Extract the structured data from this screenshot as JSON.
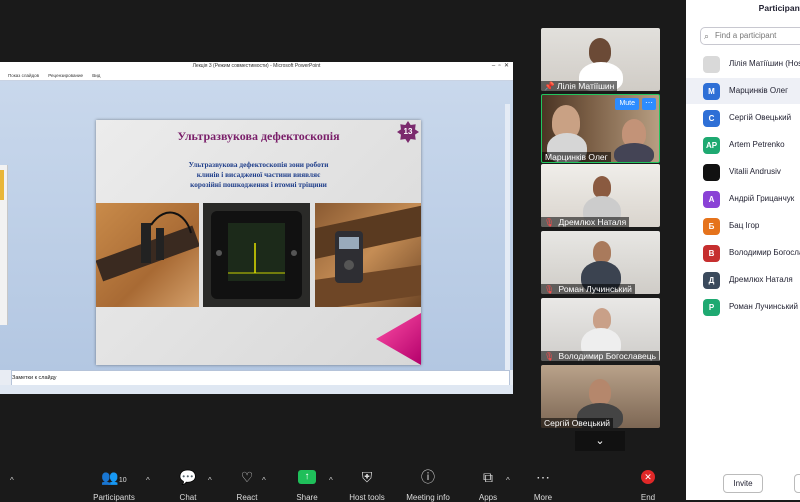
{
  "ppt": {
    "window_title": "Лекція 3 (Режим совместимости) - Microsoft PowerPoint",
    "menu_items": [
      "Показ слайдов",
      "Рецензирование",
      "Вид"
    ],
    "notes_placeholder": "Заметки к слайду"
  },
  "slide": {
    "title": "Ультразвукова дефектоскопія",
    "number": "13",
    "body_lines": [
      "Ультразвукова дефектоскопія зони роботи",
      "клинів і висадженої частини виявляє",
      "корозійні пошкодження і втомні тріщини"
    ]
  },
  "video_tiles": [
    {
      "name": "Лілія Матіїшин",
      "pinned": true
    },
    {
      "name": "Марцинків Олег",
      "active": true,
      "mute_label": "Mute"
    },
    {
      "name": "Дремлюх Наталя",
      "muted": true
    },
    {
      "name": "Роман Лучинський",
      "muted": true
    },
    {
      "name": "Володимир Богославець",
      "muted": true
    },
    {
      "name": "Сергій Овецький"
    }
  ],
  "panel": {
    "title": "Participants",
    "search_placeholder": "Find a participant",
    "participants": [
      {
        "initial": "",
        "name": "Лілія Матіїшин (Host)",
        "color": "#d9d9d9"
      },
      {
        "initial": "М",
        "name": "Марцинків Олег",
        "color": "#2e6fd6"
      },
      {
        "initial": "С",
        "name": "Сергій Овецький",
        "color": "#2e6fd6"
      },
      {
        "initial": "AP",
        "name": "Artem Petrenko",
        "color": "#1ea971"
      },
      {
        "initial": "",
        "name": "Vitalii Andrusiv",
        "color": "#111111"
      },
      {
        "initial": "А",
        "name": "Андрій Грицанчук",
        "color": "#8a42d6"
      },
      {
        "initial": "Б",
        "name": "Бац Ігор",
        "color": "#e5731c"
      },
      {
        "initial": "В",
        "name": "Володимир Богославець",
        "color": "#c62f2f"
      },
      {
        "initial": "Д",
        "name": "Дремлюх Наталя",
        "color": "#3a4a5c"
      },
      {
        "initial": "Р",
        "name": "Роман Лучинський",
        "color": "#1ea971"
      }
    ],
    "invite_label": "Invite"
  },
  "toolbar": {
    "participants_label": "Participants",
    "participants_count": "10",
    "chat_label": "Chat",
    "react_label": "React",
    "share_label": "Share",
    "host_tools_label": "Host tools",
    "meeting_info_label": "Meeting info",
    "apps_label": "Apps",
    "more_label": "More",
    "end_label": "End"
  }
}
